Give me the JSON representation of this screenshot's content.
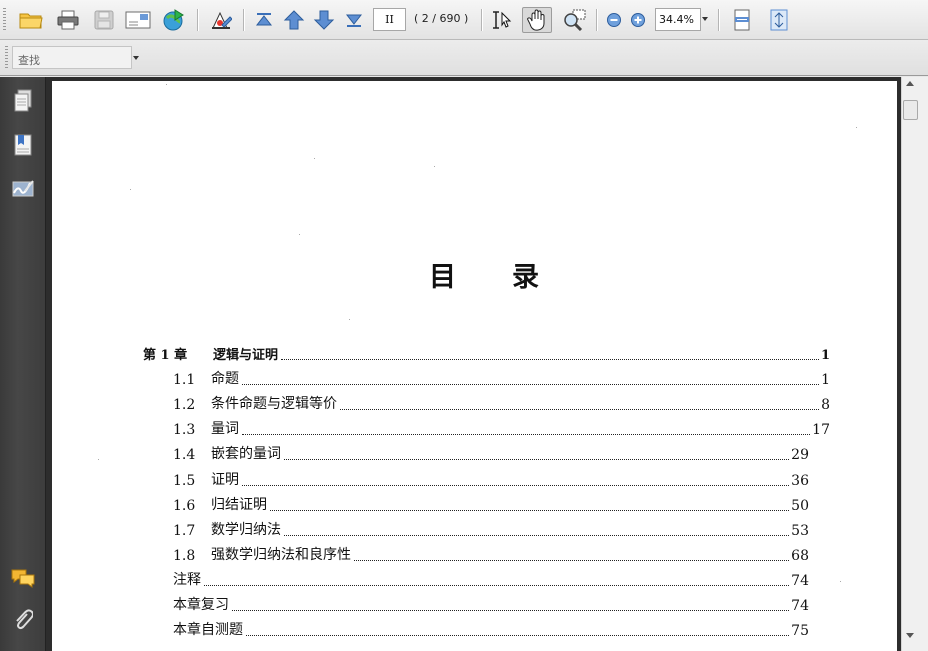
{
  "toolbar": {
    "page_value": "II",
    "page_count": "( 2 / 690 )",
    "zoom_value": "34.4%"
  },
  "find": {
    "placeholder": "查找"
  },
  "document": {
    "title": "目录",
    "entries": [
      {
        "number": "第 1 章",
        "title": "逻辑与证明",
        "page": "1",
        "level": "chapter"
      },
      {
        "number": "1.1",
        "title": "命题",
        "page": "1",
        "level": "section"
      },
      {
        "number": "1.2",
        "title": "条件命题与逻辑等价",
        "page": "8",
        "level": "section"
      },
      {
        "number": "1.3",
        "title": "量词",
        "page": "17",
        "level": "section"
      },
      {
        "number": "1.4",
        "title": "嵌套的量词",
        "page": "29",
        "level": "section"
      },
      {
        "number": "1.5",
        "title": "证明",
        "page": "36",
        "level": "section"
      },
      {
        "number": "1.6",
        "title": "归结证明",
        "page": "50",
        "level": "section"
      },
      {
        "number": "1.7",
        "title": "数学归纳法",
        "page": "53",
        "level": "section"
      },
      {
        "number": "1.8",
        "title": "强数学归纳法和良序性",
        "page": "68",
        "level": "section"
      },
      {
        "number": "",
        "title": "注释",
        "page": "74",
        "level": "back"
      },
      {
        "number": "",
        "title": "本章复习",
        "page": "74",
        "level": "back"
      },
      {
        "number": "",
        "title": "本章自测题",
        "page": "75",
        "level": "back"
      }
    ]
  },
  "icons": {
    "open": "folder-icon",
    "print": "printer-icon",
    "save": "save-icon",
    "email": "email-icon",
    "share": "globe-share-icon",
    "edit": "edit-pdf-icon",
    "first": "first-page-icon",
    "prev": "previous-page-icon",
    "next": "next-page-icon",
    "last": "last-page-icon",
    "select": "select-text-icon",
    "hand": "hand-tool-icon",
    "loupe": "loupe-zoom-icon",
    "zoom_out": "zoom-out-icon",
    "zoom_in": "zoom-in-icon",
    "fit_width": "fit-width-icon",
    "fit_page": "fit-page-icon",
    "pages_panel": "pages-panel-icon",
    "bookmarks_panel": "bookmarks-panel-icon",
    "signatures_panel": "signatures-panel-icon",
    "comments_panel": "comments-icon",
    "attachments_panel": "paperclip-icon"
  }
}
